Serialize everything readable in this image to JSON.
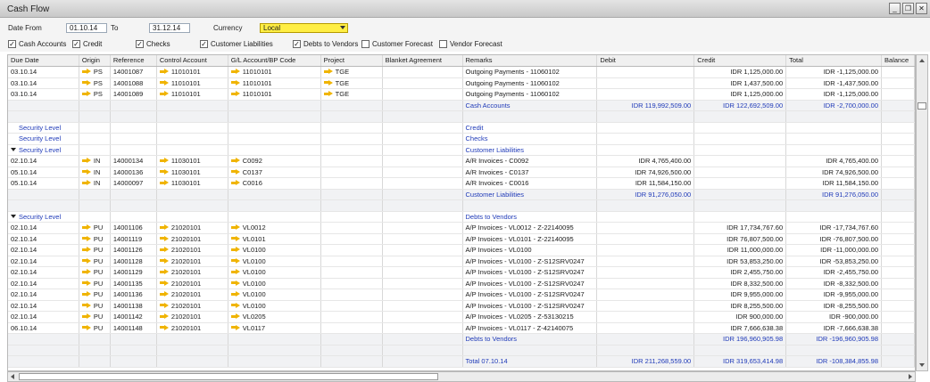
{
  "window": {
    "title": "Cash Flow"
  },
  "filters": {
    "date_from_label": "Date From",
    "date_from": "01.10.14",
    "to_label": "To",
    "date_to": "31.12.14",
    "currency_label": "Currency",
    "currency": "Local",
    "checkboxes": [
      {
        "label": "Cash Accounts",
        "checked": true
      },
      {
        "label": "Credit",
        "checked": true
      },
      {
        "label": "Checks",
        "checked": true
      },
      {
        "label": "Customer Liabilities",
        "checked": true
      },
      {
        "label": "Debts to Vendors",
        "checked": true
      },
      {
        "label": "Customer Forecast",
        "checked": false
      },
      {
        "label": "Vendor Forecast",
        "checked": false
      }
    ]
  },
  "table": {
    "columns": [
      "Due Date",
      "Origin",
      "Reference",
      "Control Account",
      "G/L Account/BP Code",
      "Project",
      "Blanket Agreement",
      "Remarks",
      "Debit",
      "Credit",
      "Total",
      "Balance"
    ],
    "rows": [
      {
        "type": "data",
        "due": "03.10.14",
        "origin": "PS",
        "ref": "14001087",
        "ctrl": "11010101",
        "gl": "11010101",
        "proj": "TGE",
        "remarks": "Outgoing Payments - 11060102",
        "debit": "",
        "credit": "IDR 1,125,000.00",
        "total": "IDR -1,125,000.00"
      },
      {
        "type": "data",
        "due": "03.10.14",
        "origin": "PS",
        "ref": "14001088",
        "ctrl": "11010101",
        "gl": "11010101",
        "proj": "TGE",
        "remarks": "Outgoing Payments - 11060102",
        "debit": "",
        "credit": "IDR 1,437,500.00",
        "total": "IDR -1,437,500.00"
      },
      {
        "type": "data",
        "due": "03.10.14",
        "origin": "PS",
        "ref": "14001089",
        "ctrl": "11010101",
        "gl": "11010101",
        "proj": "TGE",
        "remarks": "Outgoing Payments - 11060102",
        "debit": "",
        "credit": "IDR 1,125,000.00",
        "total": "IDR -1,125,000.00"
      },
      {
        "type": "sum",
        "remarks": "Cash Accounts",
        "debit": "IDR 119,992,509.00",
        "credit": "IDR 122,692,509.00",
        "total": "IDR -2,700,000.00"
      },
      {
        "type": "blank"
      },
      {
        "type": "group",
        "due": "Security Level",
        "remarks": "Credit",
        "expanded": false
      },
      {
        "type": "group",
        "due": "Security Level",
        "remarks": "Checks",
        "expanded": false
      },
      {
        "type": "group",
        "due": "Security Level",
        "remarks": "Customer Liabilities",
        "expanded": true
      },
      {
        "type": "data",
        "due": "02.10.14",
        "origin": "IN",
        "ref": "14000134",
        "ctrl": "11030101",
        "gl": "C0092",
        "proj": "",
        "remarks": "A/R Invoices - C0092",
        "debit": "IDR 4,765,400.00",
        "credit": "",
        "total": "IDR 4,765,400.00"
      },
      {
        "type": "data",
        "due": "05.10.14",
        "origin": "IN",
        "ref": "14000136",
        "ctrl": "11030101",
        "gl": "C0137",
        "proj": "",
        "remarks": "A/R Invoices - C0137",
        "debit": "IDR 74,926,500.00",
        "credit": "",
        "total": "IDR 74,926,500.00"
      },
      {
        "type": "data",
        "due": "05.10.14",
        "origin": "IN",
        "ref": "14000097",
        "ctrl": "11030101",
        "gl": "C0016",
        "proj": "",
        "remarks": "A/R Invoices - C0016",
        "debit": "IDR 11,584,150.00",
        "credit": "",
        "total": "IDR 11,584,150.00"
      },
      {
        "type": "sum",
        "remarks": "Customer Liabilities",
        "debit": "IDR 91,276,050.00",
        "credit": "",
        "total": "IDR 91,276,050.00"
      },
      {
        "type": "blank"
      },
      {
        "type": "group",
        "due": "Security Level",
        "remarks": "Debts to Vendors",
        "expanded": true
      },
      {
        "type": "data",
        "due": "02.10.14",
        "origin": "PU",
        "ref": "14001106",
        "ctrl": "21020101",
        "gl": "VL0012",
        "proj": "",
        "remarks": "A/P Invoices - VL0012 - Z-22140095",
        "debit": "",
        "credit": "IDR 17,734,767.60",
        "total": "IDR -17,734,767.60"
      },
      {
        "type": "data",
        "due": "02.10.14",
        "origin": "PU",
        "ref": "14001119",
        "ctrl": "21020101",
        "gl": "VL0101",
        "proj": "",
        "remarks": "A/P Invoices - VL0101 - Z-22140095",
        "debit": "",
        "credit": "IDR 76,807,500.00",
        "total": "IDR -76,807,500.00"
      },
      {
        "type": "data",
        "due": "02.10.14",
        "origin": "PU",
        "ref": "14001126",
        "ctrl": "21020101",
        "gl": "VL0100",
        "proj": "",
        "remarks": "A/P Invoices - VL0100",
        "debit": "",
        "credit": "IDR 11,000,000.00",
        "total": "IDR -11,000,000.00"
      },
      {
        "type": "data",
        "due": "02.10.14",
        "origin": "PU",
        "ref": "14001128",
        "ctrl": "21020101",
        "gl": "VL0100",
        "proj": "",
        "remarks": "A/P Invoices - VL0100 - Z-S12SRV0247",
        "debit": "",
        "credit": "IDR 53,853,250.00",
        "total": "IDR -53,853,250.00"
      },
      {
        "type": "data",
        "due": "02.10.14",
        "origin": "PU",
        "ref": "14001129",
        "ctrl": "21020101",
        "gl": "VL0100",
        "proj": "",
        "remarks": "A/P Invoices - VL0100 - Z-S12SRV0247",
        "debit": "",
        "credit": "IDR 2,455,750.00",
        "total": "IDR -2,455,750.00"
      },
      {
        "type": "data",
        "due": "02.10.14",
        "origin": "PU",
        "ref": "14001135",
        "ctrl": "21020101",
        "gl": "VL0100",
        "proj": "",
        "remarks": "A/P Invoices - VL0100 - Z-S12SRV0247",
        "debit": "",
        "credit": "IDR 8,332,500.00",
        "total": "IDR -8,332,500.00"
      },
      {
        "type": "data",
        "due": "02.10.14",
        "origin": "PU",
        "ref": "14001136",
        "ctrl": "21020101",
        "gl": "VL0100",
        "proj": "",
        "remarks": "A/P Invoices - VL0100 - Z-S12SRV0247",
        "debit": "",
        "credit": "IDR 9,955,000.00",
        "total": "IDR -9,955,000.00"
      },
      {
        "type": "data",
        "due": "02.10.14",
        "origin": "PU",
        "ref": "14001138",
        "ctrl": "21020101",
        "gl": "VL0100",
        "proj": "",
        "remarks": "A/P Invoices - VL0100 - Z-S12SRV0247",
        "debit": "",
        "credit": "IDR 8,255,500.00",
        "total": "IDR -8,255,500.00"
      },
      {
        "type": "data",
        "due": "02.10.14",
        "origin": "PU",
        "ref": "14001142",
        "ctrl": "21020101",
        "gl": "VL0205",
        "proj": "",
        "remarks": "A/P Invoices - VL0205 - Z-53130215",
        "debit": "",
        "credit": "IDR 900,000.00",
        "total": "IDR -900,000.00"
      },
      {
        "type": "data",
        "due": "06.10.14",
        "origin": "PU",
        "ref": "14001148",
        "ctrl": "21020101",
        "gl": "VL0117",
        "proj": "",
        "remarks": "A/P Invoices - VL0117 - Z-42140075",
        "debit": "",
        "credit": "IDR 7,666,638.38",
        "total": "IDR -7,666,638.38"
      },
      {
        "type": "sum",
        "remarks": "Debts to Vendors",
        "debit": "",
        "credit": "IDR 196,960,905.98",
        "total": "IDR -196,960,905.98"
      },
      {
        "type": "blank"
      },
      {
        "type": "sum",
        "remarks": "Total 07.10.14",
        "debit": "IDR 211,268,559.00",
        "credit": "IDR 319,653,414.98",
        "total": "IDR -108,384,855.98"
      }
    ]
  }
}
